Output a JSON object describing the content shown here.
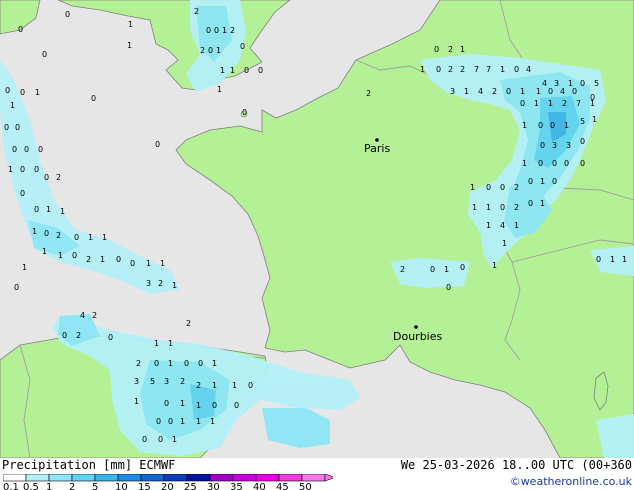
{
  "legend": {
    "title": "Precipitation [mm]",
    "model": "ECMWF",
    "date": "We 25-03-2026 18..00 UTC (00+360",
    "copyright": "©weatheronline.co.uk",
    "ticks": [
      "0.1",
      "0.5",
      "1",
      "2",
      "5",
      "10",
      "15",
      "20",
      "25",
      "30",
      "35",
      "40",
      "45",
      "50"
    ],
    "colors": [
      "#ffffff",
      "#b4f0f8",
      "#8ce6f5",
      "#60d2f2",
      "#3cb4ea",
      "#1e8ce6",
      "#1464d2",
      "#0a3cbe",
      "#0014a0",
      "#a000c8",
      "#c800dc",
      "#e600e6",
      "#f03cdc",
      "#f878e6"
    ]
  },
  "map": {
    "colors": {
      "sea": "#e6e6e6",
      "land": "#b4f096",
      "border": "#a0a0a0",
      "coast": "#808080",
      "precip_light": "#b4f0f8",
      "precip_mid": "#8ce6f5",
      "precip_high": "#60d2f2",
      "precip_max": "#3cb4ea"
    },
    "cities": [
      {
        "name": "Paris"
      },
      {
        "name": "Dourbies"
      }
    ],
    "labels": [
      "0",
      "0",
      "0",
      "1",
      "1",
      "2",
      "0",
      "0",
      "1",
      "2",
      "0",
      "2",
      "0",
      "1",
      "1",
      "1",
      "0",
      "0",
      "1",
      "0",
      "0",
      "0",
      "0",
      "0",
      "1",
      "1",
      "0",
      "0",
      "0",
      "0",
      "0",
      "1",
      "0",
      "0",
      "0",
      "2",
      "0",
      "0",
      "1",
      "1",
      "1",
      "0",
      "2",
      "0",
      "1",
      "1",
      "1",
      "0",
      "1",
      "1",
      "0",
      "2",
      "1",
      "0",
      "0",
      "1",
      "1",
      "3",
      "2",
      "1",
      "2",
      "0",
      "2",
      "1",
      "1",
      "0",
      "2",
      "2",
      "7",
      "7",
      "1",
      "0",
      "4",
      "4",
      "3",
      "1",
      "0",
      "5",
      "3",
      "1",
      "4",
      "2",
      "0",
      "1",
      "1",
      "0",
      "4",
      "0",
      "0",
      "0",
      "1",
      "1",
      "2",
      "7",
      "1",
      "1",
      "0",
      "0",
      "1",
      "5",
      "1",
      "0",
      "3",
      "3",
      "0",
      "1",
      "0",
      "0",
      "0",
      "0",
      "1",
      "0",
      "0",
      "2",
      "0",
      "1",
      "0",
      "1",
      "1",
      "0",
      "2",
      "0",
      "1",
      "1",
      "4",
      "1",
      "1",
      "1",
      "2",
      "0",
      "1",
      "0",
      "0",
      "0",
      "1",
      "1",
      "4",
      "2",
      "0",
      "2",
      "0",
      "1",
      "1",
      "2",
      "2",
      "0",
      "1",
      "0",
      "0",
      "1",
      "3",
      "5",
      "3",
      "2",
      "2",
      "1",
      "1",
      "0",
      "1",
      "0",
      "1",
      "1",
      "0",
      "0",
      "0",
      "0",
      "1",
      "1",
      "1",
      "0",
      "0",
      "1"
    ]
  }
}
